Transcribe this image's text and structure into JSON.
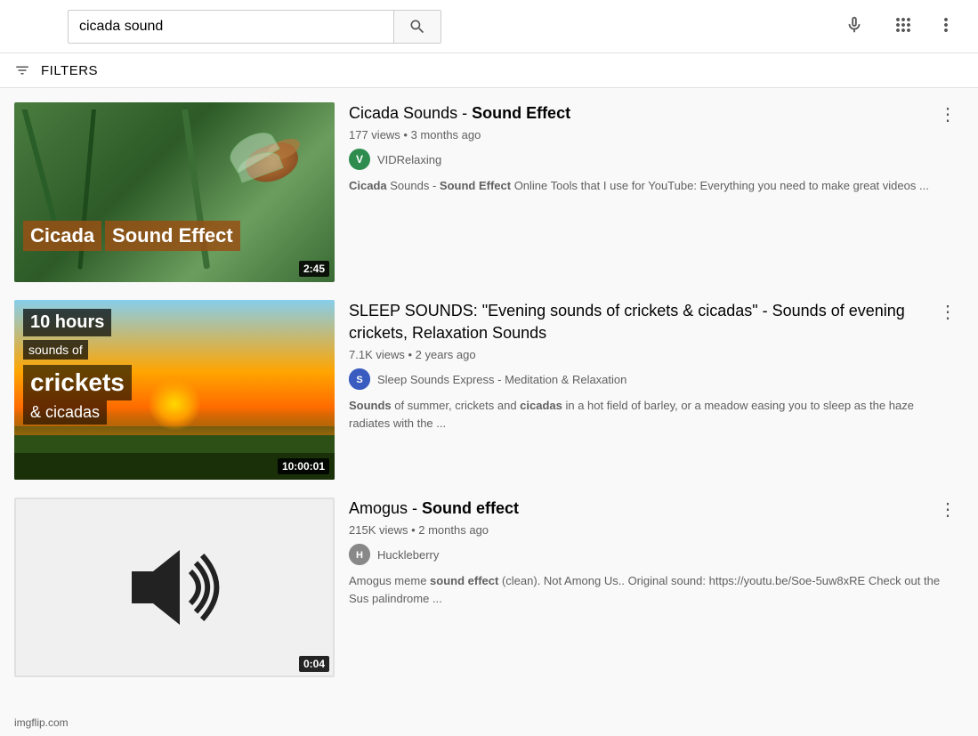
{
  "header": {
    "search_value": "cicada sound",
    "search_placeholder": "Search",
    "filters_label": "FILTERS"
  },
  "videos": [
    {
      "id": "v1",
      "title_html": "Cicada Sounds - <b>Sound Effect</b>",
      "title_plain": "Cicada Sounds - Sound Effect",
      "views": "177 views",
      "age": "3 months ago",
      "meta": "177 views • 3 months ago",
      "channel_name": "VIDRelaxing",
      "channel_avatar_letter": "V",
      "channel_avatar_class": "avatar-green",
      "description": "Cicada Sounds - Sound Effect Online Tools that I use for YouTube: Everything you need to make great videos ...",
      "duration": "2:45",
      "thumbnail_type": "cicada"
    },
    {
      "id": "v2",
      "title_html": "SLEEP SOUNDS: \"Evening sounds of crickets & cicadas\" - Sounds of evening crickets, Relaxation Sounds",
      "title_plain": "SLEEP SOUNDS: \"Evening sounds of crickets & cicadas\" - Sounds of evening crickets, Relaxation Sounds",
      "views": "7.1K views",
      "age": "2 years ago",
      "meta": "7.1K views • 2 years ago",
      "channel_name": "Sleep Sounds Express - Meditation & Relaxation",
      "channel_avatar_letter": "S",
      "channel_avatar_class": "avatar-blue",
      "description": "Sounds of summer, crickets and cicadas in a hot field of barley, or a meadow easing you to sleep as the haze radiates with the ...",
      "duration": "10:00:01",
      "thumbnail_type": "cricket"
    },
    {
      "id": "v3",
      "title_html": "Amogus - <b>Sound effect</b>",
      "title_plain": "Amogus - Sound effect",
      "views": "215K views",
      "age": "2 months ago",
      "meta": "215K views • 2 months ago",
      "channel_name": "Huckleberry",
      "channel_avatar_letter": "H",
      "channel_avatar_class": "avatar-gray",
      "description": "Amogus meme sound effect (clean). Not Among Us.. Original sound: https://youtu.be/Soe-5uw8xRE Check out the Sus palindrome ...",
      "duration": "0:04",
      "thumbnail_type": "amogus"
    }
  ],
  "footer": {
    "text": "imgflip.com"
  }
}
